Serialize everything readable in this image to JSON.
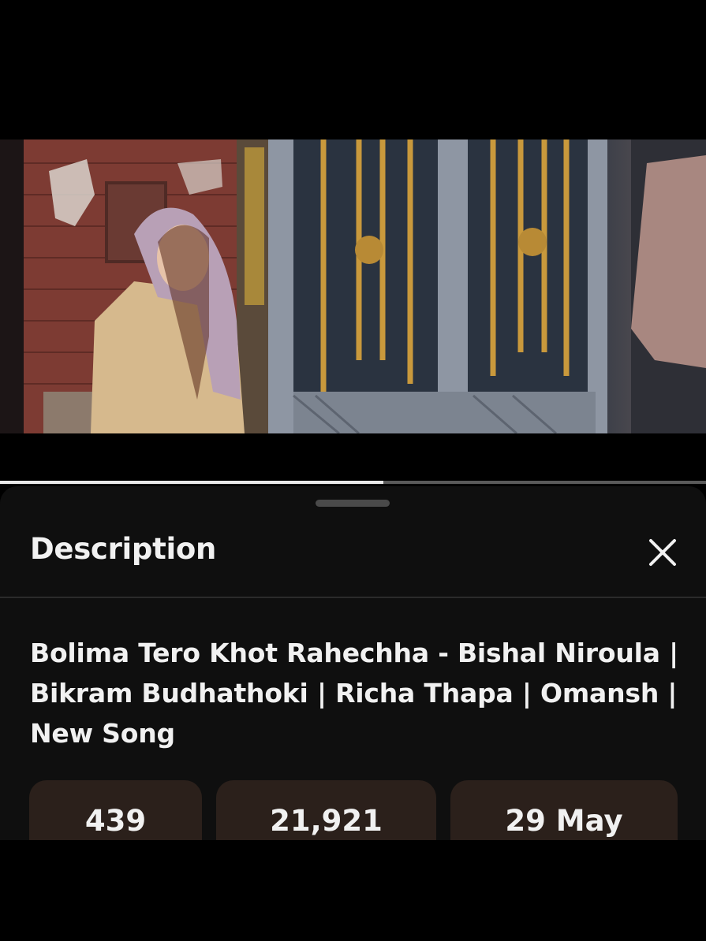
{
  "player": {
    "progress_fraction": 0.543
  },
  "sheet": {
    "title": "Description",
    "close_icon": "close-icon"
  },
  "video": {
    "title": "Bolima Tero Khot Rahechha - Bishal Niroula | Bikram Budhathoki | Richa Thapa | Omansh | New Song"
  },
  "stats": {
    "likes": "439",
    "views": "21,921",
    "date": "29 May"
  },
  "colors": {
    "sheet_bg": "#0f0f0f",
    "stat_bg": "#2b201b",
    "text": "#f1f1f1",
    "progress_fill": "#e8e8e8",
    "progress_track": "#5a5a5a"
  }
}
